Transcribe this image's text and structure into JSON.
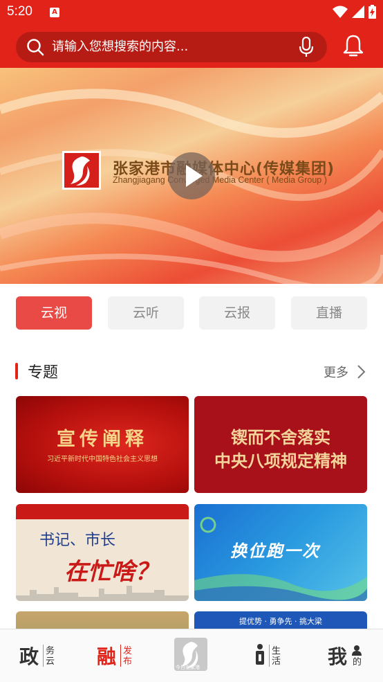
{
  "status_bar": {
    "time": "5:20",
    "app_badge": "A",
    "icons": [
      "wifi-icon",
      "signal-icon",
      "battery-charging-icon"
    ]
  },
  "header": {
    "search_placeholder": "请输入您想搜索的内容...",
    "icons": [
      "search-icon",
      "microphone-icon",
      "bell-icon"
    ]
  },
  "banner": {
    "title": "张家港市融媒体中心(传媒集团)",
    "subtitle": "Zhangjiagang Converged Media Center ( Media Group )",
    "icons": [
      "logo-icon",
      "play-icon"
    ]
  },
  "tabs": [
    {
      "label": "云视",
      "active": true
    },
    {
      "label": "云听",
      "active": false
    },
    {
      "label": "云报",
      "active": false
    },
    {
      "label": "直播",
      "active": false
    }
  ],
  "section": {
    "title": "专题",
    "more_label": "更多"
  },
  "cards": {
    "card1": {
      "title": "宣传阐释",
      "subtitle": "习近平新时代中国特色社会主义思想"
    },
    "card2": {
      "line1": "锲而不舍落实",
      "line2": "中央八项规定精神"
    },
    "card3": {
      "line1": "书记、市长",
      "line2": "在忙啥？"
    },
    "card4": {
      "title": "换位跑一次"
    },
    "card6": {
      "text": "提优势 · 勇争先 · 挑大梁"
    }
  },
  "bottom_nav": [
    {
      "main": "政",
      "sub": "务云",
      "color": "#333333",
      "active": false
    },
    {
      "main": "融",
      "sub": "发布",
      "color": "#e2231a",
      "active": true
    },
    {
      "logo_text": "今日张家港",
      "active": false
    },
    {
      "main": "",
      "sub": "生活",
      "color": "#333333",
      "active": false
    },
    {
      "main": "我",
      "sub": "的",
      "color": "#333333",
      "active": false
    }
  ],
  "colors": {
    "brand_red": "#e2231a",
    "active_tab": "#e94a45"
  }
}
